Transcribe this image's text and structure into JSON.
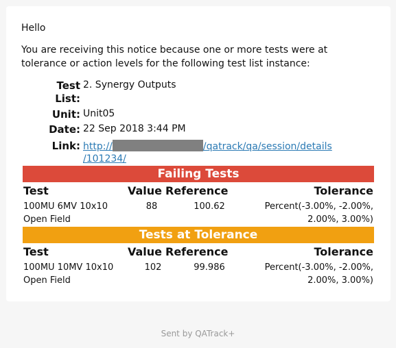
{
  "greeting": "Hello",
  "intro": "You are receiving this notice because one or more tests were at tolerance or action levels for the following test list instance:",
  "meta": {
    "test_list_label_1": "Test",
    "test_list_label_2": "List:",
    "test_list_value": "2. Synergy Outputs",
    "unit_label": "Unit:",
    "unit_value": "Unit05",
    "date_label": "Date:",
    "date_value": "22 Sep 2018 3:44 PM",
    "link_label": "Link:",
    "link_prefix": "http://",
    "link_suffix_1": "/qatrack/qa/session/details",
    "link_suffix_2": "/101234/"
  },
  "failing": {
    "title": "Failing Tests",
    "headers": {
      "test": "Test",
      "value": "Value",
      "reference": "Reference",
      "tolerance": "Tolerance"
    },
    "rows": [
      {
        "test_1": "100MU 6MV 10x10",
        "test_2": "Open Field",
        "value": "88",
        "reference": "100.62",
        "tolerance_1": "Percent(-3.00%, -2.00%,",
        "tolerance_2": "2.00%, 3.00%)"
      }
    ]
  },
  "tolerance": {
    "title": "Tests at Tolerance",
    "headers": {
      "test": "Test",
      "value": "Value",
      "reference": "Reference",
      "tolerance": "Tolerance"
    },
    "rows": [
      {
        "test_1": "100MU 10MV 10x10",
        "test_2": "Open Field",
        "value": "102",
        "reference": "99.986",
        "tolerance_1": "Percent(-3.00%, -2.00%,",
        "tolerance_2": "2.00%, 3.00%)"
      }
    ]
  },
  "footer": "Sent by QATrack+",
  "colors": {
    "failing": "#dc4a3a",
    "tolerance": "#f1a011",
    "link": "#2b7ab4"
  }
}
